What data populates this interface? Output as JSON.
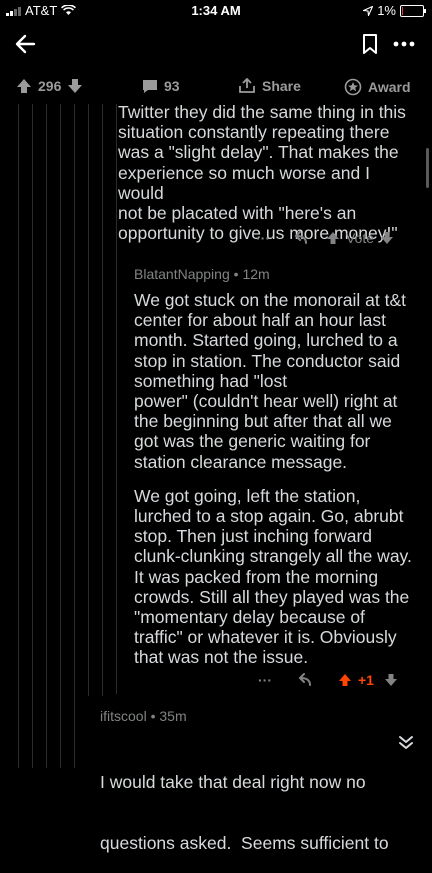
{
  "status": {
    "carrier": "AT&T",
    "time": "1:34 AM",
    "battery": "1%"
  },
  "actionbar": {
    "upvotes": "296",
    "comments": "93",
    "share": "Share",
    "award": "Award"
  },
  "comment1": {
    "lines": [
      "Twitter they did the same thing in this",
      "situation constantly repeating there",
      "was a \"slight delay\". That makes the",
      "experience so much worse and I would",
      "not be placated with \"here's an",
      "opportunity to give us more money!\""
    ],
    "vote_label": "Vote"
  },
  "comment2": {
    "author": "BlatantNapping",
    "age": "12m",
    "para1": [
      "We got stuck on the monorail at t&t",
      "center for about half an hour last",
      "month. Started going, lurched to a",
      "stop in station. The conductor said",
      "something had \"lost",
      "power\" (couldn't hear well) right at",
      "the beginning but after that all we",
      "got was the generic waiting for",
      "station clearance message."
    ],
    "para2": [
      "We got going, left the station,",
      "lurched to a stop again. Go, abrubt",
      "stop. Then just inching forward",
      "clunk-clunking strangely all the way.",
      "It was packed from the morning",
      "crowds. Still all they played was the",
      "\"momentary delay because of",
      "traffic\" or whatever it is. Obviously",
      "that was not the issue."
    ],
    "score": "+1",
    "upvote_color": "#ff4500"
  },
  "comment3": {
    "author": "ifitscool",
    "age": "35m",
    "lines": [
      "I would take that deal right now no",
      "questions asked.  Seems sufficient to"
    ]
  },
  "colors": {
    "background": "#000000",
    "text": "#d7dadc",
    "meta": "#818384",
    "accent": "#ff4500"
  }
}
